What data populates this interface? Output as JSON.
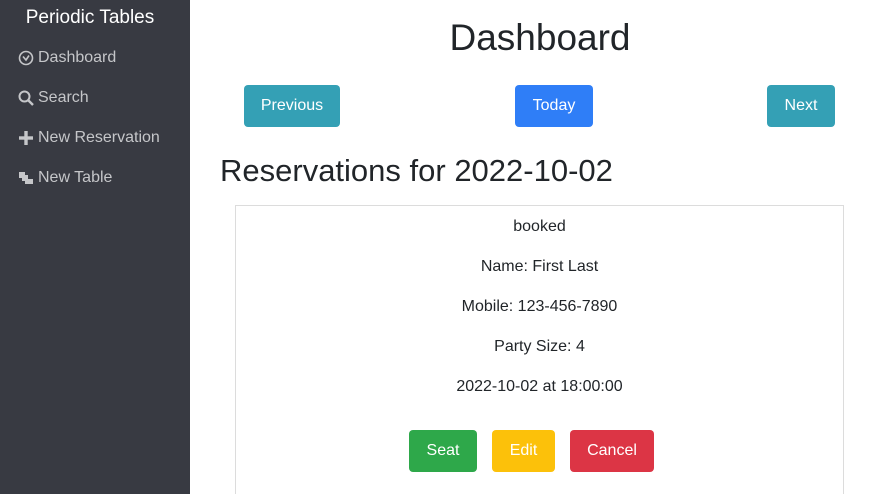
{
  "sidebar": {
    "brand": "Periodic Tables",
    "items": [
      {
        "label": "Dashboard",
        "icon": "dashboard-icon"
      },
      {
        "label": "Search",
        "icon": "search-icon"
      },
      {
        "label": "New Reservation",
        "icon": "plus-icon"
      },
      {
        "label": "New Table",
        "icon": "layers-icon"
      }
    ]
  },
  "main": {
    "title": "Dashboard",
    "nav_buttons": {
      "previous": "Previous",
      "today": "Today",
      "next": "Next"
    },
    "reservations_heading": "Reservations for 2022-10-02",
    "reservation": {
      "status": "booked",
      "name": "Name: First Last",
      "mobile": "Mobile: 123-456-7890",
      "party_size": "Party Size: 4",
      "datetime": "2022-10-02 at 18:00:00",
      "actions": {
        "seat": "Seat",
        "edit": "Edit",
        "cancel": "Cancel"
      }
    }
  },
  "colors": {
    "sidebar_bg": "#383a42",
    "info": "#34a0b5",
    "primary": "#2f7ef7",
    "success": "#2ea84a",
    "warning": "#fcc10a",
    "danger": "#dc3545"
  }
}
